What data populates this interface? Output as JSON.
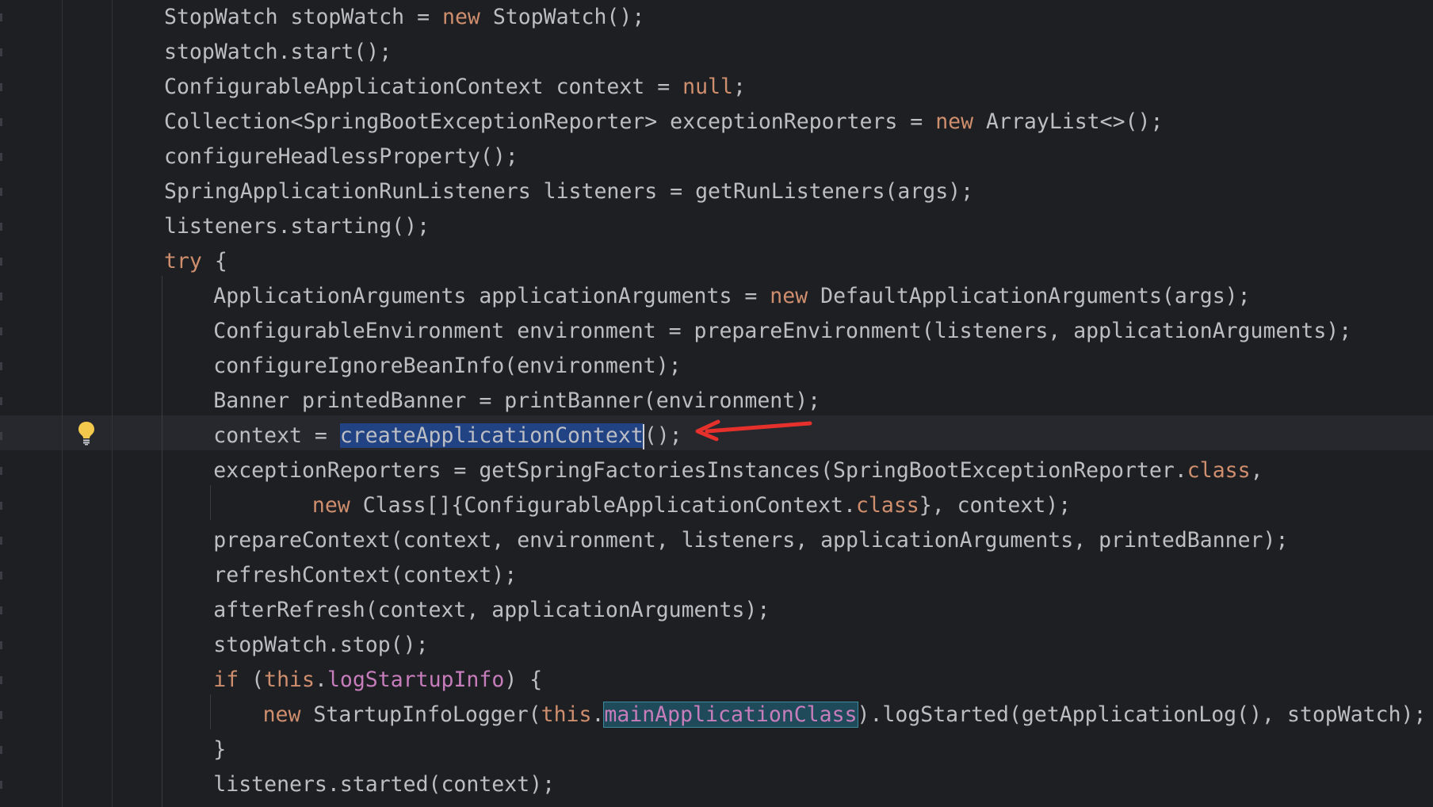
{
  "editor": {
    "lines": [
      {
        "indent": 0,
        "parts": [
          {
            "t": "StopWatch stopWatch = "
          },
          {
            "t": "new",
            "c": "kw"
          },
          {
            "t": " StopWatch();"
          }
        ]
      },
      {
        "indent": 0,
        "parts": [
          {
            "t": "stopWatch.start();"
          }
        ]
      },
      {
        "indent": 0,
        "parts": [
          {
            "t": "ConfigurableApplicationContext context = "
          },
          {
            "t": "null",
            "c": "kw"
          },
          {
            "t": ";"
          }
        ]
      },
      {
        "indent": 0,
        "parts": [
          {
            "t": "Collection<SpringBootExceptionReporter> exceptionReporters = "
          },
          {
            "t": "new",
            "c": "kw"
          },
          {
            "t": " ArrayList<>();"
          }
        ]
      },
      {
        "indent": 0,
        "parts": [
          {
            "t": "configureHeadlessProperty();"
          }
        ]
      },
      {
        "indent": 0,
        "parts": [
          {
            "t": "SpringApplicationRunListeners listeners = getRunListeners(args);"
          }
        ]
      },
      {
        "indent": 0,
        "parts": [
          {
            "t": "listeners.starting();"
          }
        ]
      },
      {
        "indent": 0,
        "parts": [
          {
            "t": "try",
            "c": "kw"
          },
          {
            "t": " {"
          }
        ]
      },
      {
        "indent": 1,
        "parts": [
          {
            "t": "ApplicationArguments applicationArguments = "
          },
          {
            "t": "new",
            "c": "kw"
          },
          {
            "t": " DefaultApplicationArguments(args);"
          }
        ]
      },
      {
        "indent": 1,
        "parts": [
          {
            "t": "ConfigurableEnvironment environment = prepareEnvironment(listeners, applicationArguments);"
          }
        ]
      },
      {
        "indent": 1,
        "parts": [
          {
            "t": "configureIgnoreBeanInfo(environment);"
          }
        ]
      },
      {
        "indent": 1,
        "parts": [
          {
            "t": "Banner printedBanner = printBanner(environment);"
          }
        ]
      },
      {
        "indent": 1,
        "current": true,
        "parts": [
          {
            "t": "context = "
          },
          {
            "t": "createApplicationContext",
            "c": "sel-word"
          },
          {
            "caret": true
          },
          {
            "t": "();"
          }
        ]
      },
      {
        "indent": 1,
        "parts": [
          {
            "t": "exceptionReporters = getSpringFactoriesInstances(SpringBootExceptionReporter."
          },
          {
            "t": "class",
            "c": "kw"
          },
          {
            "t": ","
          }
        ]
      },
      {
        "indent": 3,
        "parts": [
          {
            "t": "new",
            "c": "kw"
          },
          {
            "t": " Class[]{ConfigurableApplicationContext."
          },
          {
            "t": "class",
            "c": "kw"
          },
          {
            "t": "}, context);"
          }
        ]
      },
      {
        "indent": 1,
        "parts": [
          {
            "t": "prepareContext(context, environment, listeners, applicationArguments, printedBanner);"
          }
        ]
      },
      {
        "indent": 1,
        "parts": [
          {
            "t": "refreshContext(context);"
          }
        ]
      },
      {
        "indent": 1,
        "parts": [
          {
            "t": "afterRefresh(context, applicationArguments);"
          }
        ]
      },
      {
        "indent": 1,
        "parts": [
          {
            "t": "stopWatch.stop();"
          }
        ]
      },
      {
        "indent": 1,
        "parts": [
          {
            "t": "if",
            "c": "kw"
          },
          {
            "t": " ("
          },
          {
            "t": "this",
            "c": "kw"
          },
          {
            "t": "."
          },
          {
            "t": "logStartupInfo",
            "c": "fld"
          },
          {
            "t": ") {"
          }
        ]
      },
      {
        "indent": 2,
        "parts": [
          {
            "t": "new",
            "c": "kw"
          },
          {
            "t": " StartupInfoLogger("
          },
          {
            "t": "this",
            "c": "kw"
          },
          {
            "t": "."
          },
          {
            "t": "mainApplicationClass",
            "c": "hl-word"
          },
          {
            "t": ").logStarted(getApplicationLog(), stopWatch);"
          }
        ]
      },
      {
        "indent": 1,
        "parts": [
          {
            "t": "}"
          }
        ]
      },
      {
        "indent": 1,
        "parts": [
          {
            "t": "listeners.started(context);"
          }
        ]
      }
    ],
    "intention_icon": "lightbulb-icon",
    "annotation_icon": "red-arrow-icon",
    "colors": {
      "background": "#1e1f22",
      "text": "#bcbec4",
      "keyword": "#cf8e6d",
      "field": "#c77dbb",
      "selection": "#214283",
      "identifier_highlight": "#1f4a5a",
      "arrow": "#e5302b",
      "bulb": "#f2c94c"
    }
  }
}
